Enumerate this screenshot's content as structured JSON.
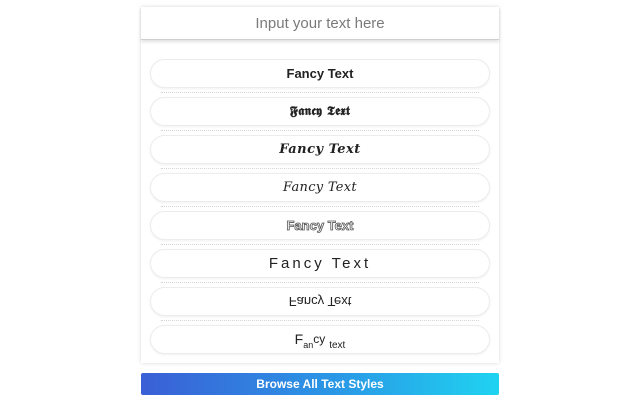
{
  "input": {
    "placeholder": "Input your text here",
    "value": ""
  },
  "styles": [
    {
      "id": "bold",
      "text": "Fancy Text"
    },
    {
      "id": "gothic",
      "text": "𝕱𝖆𝖓𝖈𝖞 𝕿𝖊𝖝𝖙"
    },
    {
      "id": "bold-italic-script",
      "text": "Fancy Text"
    },
    {
      "id": "italic-script",
      "text": "Fancy Text"
    },
    {
      "id": "outline",
      "text": "Fancy Text"
    },
    {
      "id": "spaced",
      "text": "Fancy Text"
    },
    {
      "id": "flipped",
      "text": "Fancy Text"
    },
    {
      "id": "wavy",
      "parts": {
        "a": "F",
        "b": "an",
        "c": "cy",
        "d": "text"
      }
    }
  ],
  "browse_button": {
    "label": "Browse All Text Styles"
  },
  "colors": {
    "button_gradient_start": "#3a5fd6",
    "button_gradient_end": "#1fd3f0",
    "button_text": "#ffffff"
  }
}
